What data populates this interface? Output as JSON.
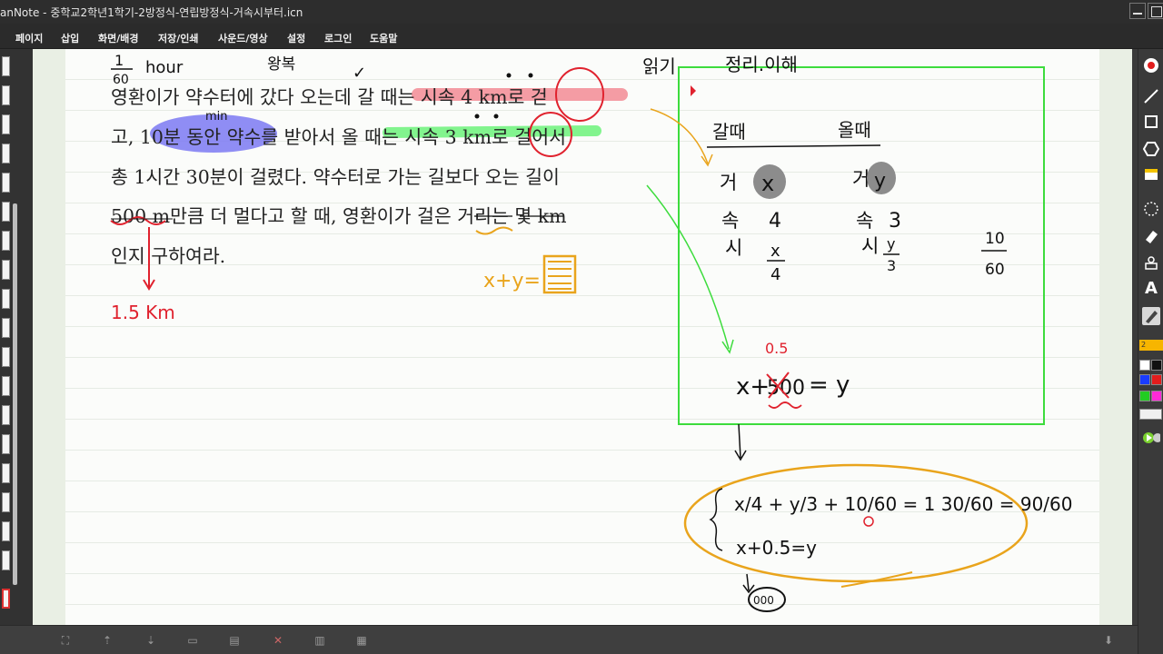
{
  "window": {
    "title": "anNote - 중학교2학년1학기-2방정식-연립방정식-거속시부터.icn"
  },
  "menu": [
    "페이지",
    "삽입",
    "화면/배경",
    "저장/인쇄",
    "사운드/영상",
    "설정",
    "로그인",
    "도움말"
  ],
  "problem": {
    "lines": [
      "영환이가 약수터에 갔다 오는데 갈 때는 시속 4 km로 걷",
      "고, 10분 동안 약수를 받아서 올 때는 시속 3 km로 걸어서",
      "총 1시간 30분이 걸렸다. 약수터로 가는 길보다 오는 길이",
      "500 m만큼 더 멀다고 할 때, 영환이가 걸은 거리는 몇 km",
      "인지 구하여라."
    ]
  },
  "annotations": {
    "frac_top": "1",
    "frac_bottom": "60",
    "hour": "hour",
    "min": "min",
    "wangbok": "왕복",
    "check": "✓",
    "answer": "1.5 Km",
    "xy_box": "x+y=",
    "read_label": "읽기",
    "organize_label": "정리.이해",
    "go_label": "갈때",
    "come_label": "올때",
    "go_dist": "거",
    "go_x": "x",
    "come_dist": "거",
    "come_y": "y",
    "speed_label": "속",
    "go_speed": "4",
    "come_speed": "3",
    "time_label": "시",
    "go_time_num": "x",
    "go_time_den": "4",
    "come_time_num": "y",
    "come_time_den": "3",
    "rest_num": "10",
    "rest_den": "60",
    "relation_left": "x+",
    "relation_500": "500",
    "relation_05": "0.5",
    "relation_right": "= y",
    "eq1": "x/4 + y/3 + 10/60 = 1 30/60 = 90/60",
    "eq2": "x+0.5=y",
    "bubble": "000"
  },
  "toolbar": {
    "tools": [
      "record-icon",
      "line-icon",
      "rectangle-icon",
      "hexagon-icon",
      "sticky-note-icon",
      "lasso-icon",
      "eraser-icon",
      "stamp-icon",
      "text-icon",
      "pen-icon"
    ],
    "palette_label": "2",
    "colors": [
      "#ffffff",
      "#111111",
      "#e11d1d",
      "#1a3cff",
      "#7a2ad8",
      "#ff2ad8",
      "#22cc22",
      "#22c6ff"
    ]
  },
  "bottom_tools": [
    "fit-page-icon",
    "page-up-icon",
    "page-down-icon",
    "copy-page-icon",
    "paste-page-icon",
    "delete-page-icon",
    "two-page-icon",
    "nine-page-icon"
  ]
}
